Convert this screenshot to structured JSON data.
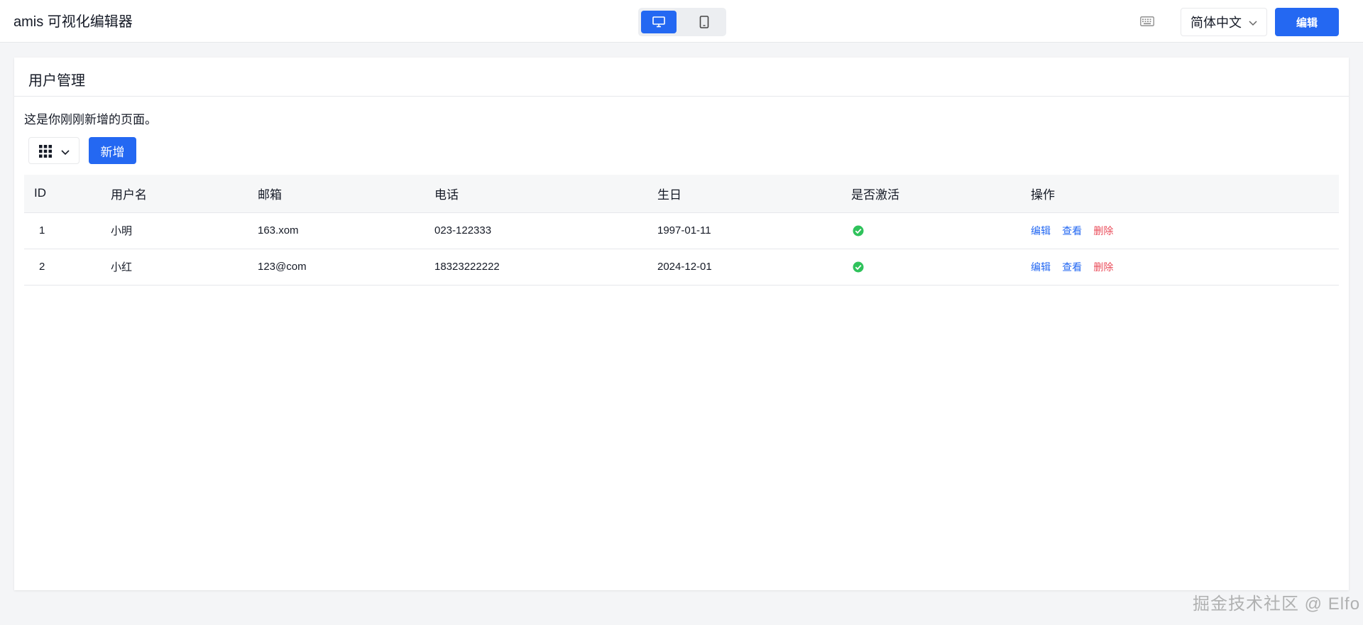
{
  "header": {
    "app_title": "amis 可视化编辑器",
    "device_switch": {
      "pc_icon": "monitor-icon",
      "mobile_icon": "tablet-icon",
      "active": "pc"
    },
    "keyboard_icon": "keyboard-icon",
    "language": "简体中文",
    "edit_label": "编辑",
    "accent_color": "#2468f2"
  },
  "page": {
    "title": "用户管理",
    "description": "这是你刚刚新增的页面。",
    "toolbar": {
      "columns_icon": "grid-icon",
      "add_label": "新增"
    }
  },
  "table": {
    "columns": [
      "ID",
      "用户名",
      "邮箱",
      "电话",
      "生日",
      "是否激活",
      "操作"
    ],
    "rows": [
      {
        "id": "1",
        "username": "小明",
        "email": "163.xom",
        "phone": "023-122333",
        "birthday": "1997-01-11",
        "active": true
      },
      {
        "id": "2",
        "username": "小红",
        "email": "123@com",
        "phone": "18323222222",
        "birthday": "2024-12-01",
        "active": true
      }
    ],
    "actions": {
      "edit": "编辑",
      "view": "查看",
      "delete": "删除"
    },
    "active_color": "#2fc25b",
    "delete_color": "#ea4c5a"
  },
  "watermark": "掘金技术社区 @ Elfo"
}
